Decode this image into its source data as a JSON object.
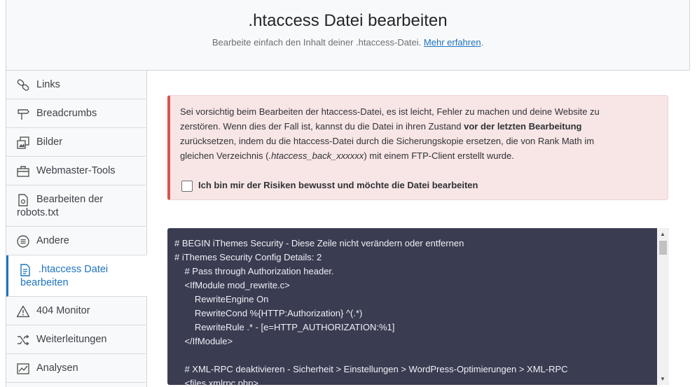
{
  "header": {
    "title": ".htaccess Datei bearbeiten",
    "subtitle": "Bearbeite einfach den Inhalt deiner .htaccess-Datei.",
    "learn_more": "Mehr erfahren",
    "period": "."
  },
  "sidebar": {
    "items": [
      {
        "label": "Links",
        "icon": "link-icon"
      },
      {
        "label": "Breadcrumbs",
        "icon": "signpost-icon"
      },
      {
        "label": "Bilder",
        "icon": "image-icon"
      },
      {
        "label": "Webmaster-Tools",
        "icon": "toolbox-icon"
      },
      {
        "label": "Bearbeiten der robots.txt",
        "icon": "file-icon"
      },
      {
        "label": "Andere",
        "icon": "list-circle-icon"
      },
      {
        "label": ".htaccess Datei bearbeiten",
        "icon": "document-icon",
        "active": true
      },
      {
        "label": "404 Monitor",
        "icon": "warning-icon"
      },
      {
        "label": "Weiterleitungen",
        "icon": "shuffle-icon"
      },
      {
        "label": "Analysen",
        "icon": "chart-icon"
      }
    ]
  },
  "warning": {
    "text_1": "Sei vorsichtig beim Bearbeiten der htaccess-Datei, es ist leicht, Fehler zu machen und deine Website zu zerstören. Wenn dies der Fall ist, kannst du die Datei in ihren Zustand ",
    "text_bold": "vor der letzten Bearbeitung",
    "text_2": " zurücksetzen, indem du die htaccess-Datei durch die Sicherungskopie ersetzen, die von Rank Math im gleichen Verzeichnis (",
    "text_italic": ".htaccess_back_xxxxxx",
    "text_3": ") mit einem FTP-Client erstellt wurde.",
    "checkbox_label": "Ich bin mir der Risiken bewusst und möchte die Datei bearbeiten",
    "accent": "#d9534f"
  },
  "editor": {
    "content": "# BEGIN iThemes Security - Diese Zeile nicht verändern oder entfernen\n# iThemes Security Config Details: 2\n\t# Pass through Authorization header.\n\t<IfModule mod_rewrite.c>\n\t\tRewriteEngine On\n\t\tRewriteCond %{HTTP:Authorization} ^(.*)\n\t\tRewriteRule .* - [e=HTTP_AUTHORIZATION:%1]\n\t</IfModule>\n\n\t# XML-RPC deaktivieren - Sicherheit > Einstellungen > WordPress-Optimierungen > XML-RPC\n\t<files xmlrpc.php>",
    "background": "#3a3c52"
  }
}
